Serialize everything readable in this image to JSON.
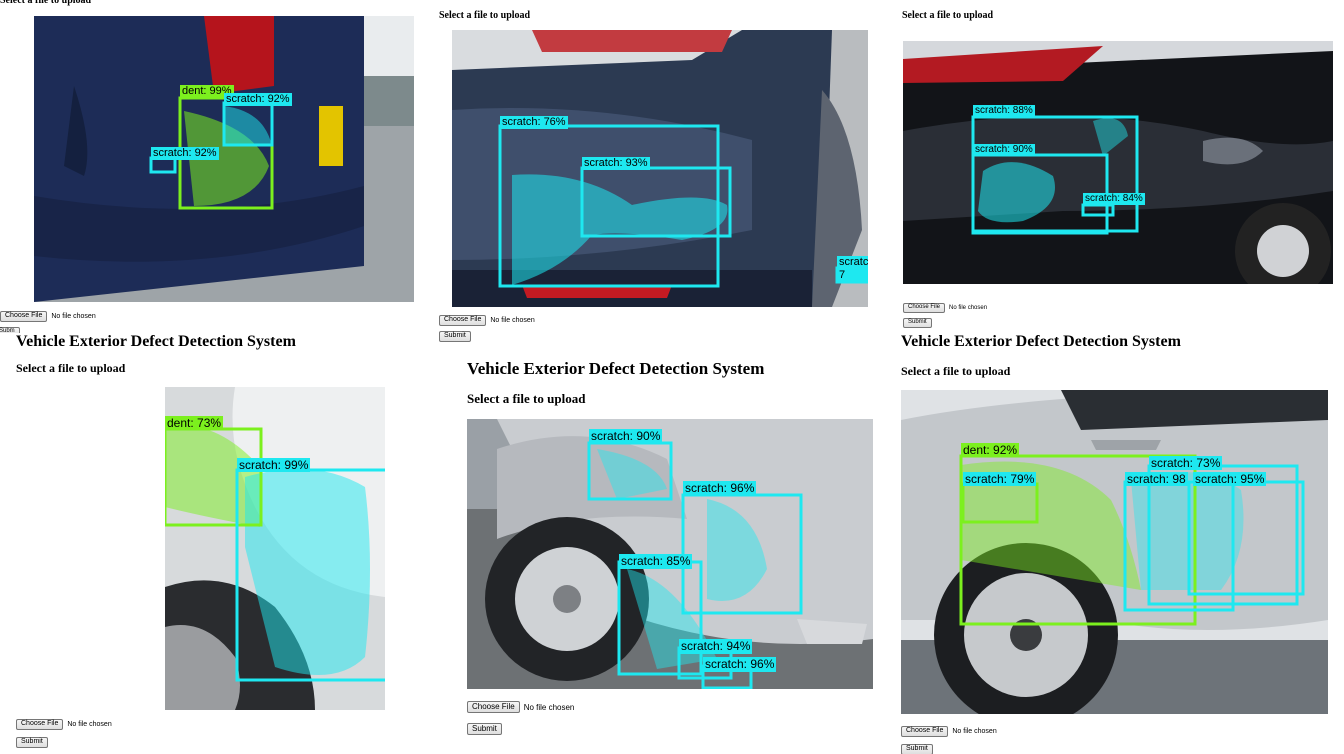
{
  "app": {
    "title": "Vehicle Exterior Defect Detection System",
    "upload_prompt": "Select a file to upload",
    "choose_file_label": "Choose File",
    "no_file_text": "No file chosen",
    "submit_label": "Submit",
    "submit_label_cropped": "Subm"
  },
  "colors": {
    "dent": "#7cf01e",
    "scratch": "#1ee8f0"
  },
  "panels": [
    {
      "id": "panel-1",
      "detections": [
        {
          "label": "dent: 99%",
          "class": "dent"
        },
        {
          "label": "scratch: 92%",
          "class": "scratch"
        },
        {
          "label": "scratch: 92%",
          "class": "scratch"
        }
      ]
    },
    {
      "id": "panel-2",
      "detections": [
        {
          "label": "scratch: 76%",
          "class": "scratch"
        },
        {
          "label": "scratch: 93%",
          "class": "scratch"
        },
        {
          "label": "scratch: 7",
          "class": "scratch"
        }
      ]
    },
    {
      "id": "panel-3",
      "detections": [
        {
          "label": "scratch: 88%",
          "class": "scratch"
        },
        {
          "label": "scratch: 90%",
          "class": "scratch"
        },
        {
          "label": "scratch: 84%",
          "class": "scratch"
        }
      ]
    },
    {
      "id": "panel-4",
      "detections": [
        {
          "label": "dent: 73%",
          "class": "dent"
        },
        {
          "label": "scratch: 99%",
          "class": "scratch"
        }
      ]
    },
    {
      "id": "panel-5",
      "detections": [
        {
          "label": "scratch: 90%",
          "class": "scratch"
        },
        {
          "label": "scratch: 96%",
          "class": "scratch"
        },
        {
          "label": "scratch: 85%",
          "class": "scratch"
        },
        {
          "label": "scratch: 94%",
          "class": "scratch"
        },
        {
          "label": "scratch: 96%",
          "class": "scratch"
        }
      ]
    },
    {
      "id": "panel-6",
      "detections": [
        {
          "label": "dent: 92%",
          "class": "dent"
        },
        {
          "label": "scratch: 79%",
          "class": "scratch"
        },
        {
          "label": "scratch: 73%",
          "class": "scratch"
        },
        {
          "label": "scratch: 98",
          "class": "scratch"
        },
        {
          "label": "scratch: 95%",
          "class": "scratch"
        }
      ]
    }
  ]
}
